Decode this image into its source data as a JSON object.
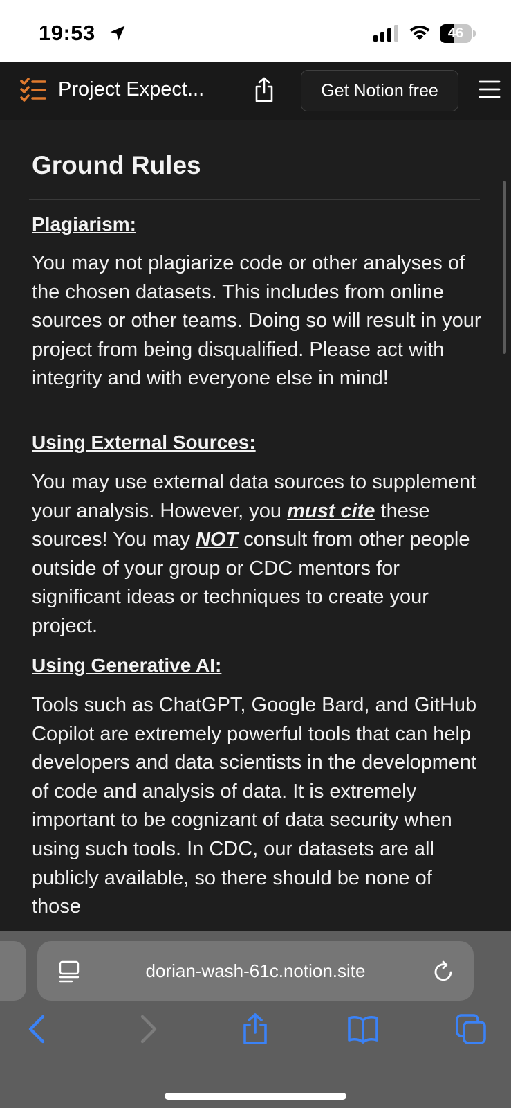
{
  "status_bar": {
    "time": "19:53",
    "battery": "46",
    "battery_level": 0.46
  },
  "header": {
    "page_title": "Project Expect...",
    "cta_label": "Get Notion free",
    "icons": [
      "checklist-icon",
      "share-icon",
      "menu-icon"
    ],
    "accent_color": "#e07a2e"
  },
  "content": {
    "heading": "Ground Rules",
    "sections": [
      {
        "title": "Plagiarism:",
        "body": "You may not plagiarize code or other analyses of the chosen datasets. This includes from online sources or other teams. Doing so will result in your project from being disqualified. Please act with integrity and with everyone else in mind!"
      },
      {
        "title": "Using External Sources:",
        "body_parts": {
          "part1": "You may use external data sources to supplement your analysis. However, you ",
          "emph1": "must cite",
          "part2": " these sources! You may ",
          "emph2": "NOT",
          "part3": " consult from other people outside of your group or CDC mentors for significant ideas or techniques to create your project."
        }
      },
      {
        "title": "Using Generative AI:",
        "body": "Tools such as ChatGPT, Google Bard, and GitHub Copilot are extremely powerful tools that can help developers and data scientists in the development of code and analysis of data. It is extremely important to be cognizant of data security when using such tools. In CDC, our datasets are all publicly available, so there should be none of those"
      }
    ]
  },
  "safari": {
    "url": "dorian-wash-61c.notion.site",
    "toolbar": [
      "back-icon",
      "forward-icon",
      "share-icon",
      "bookmarks-icon",
      "tabs-icon"
    ],
    "accent_color": "#3b82f6"
  }
}
